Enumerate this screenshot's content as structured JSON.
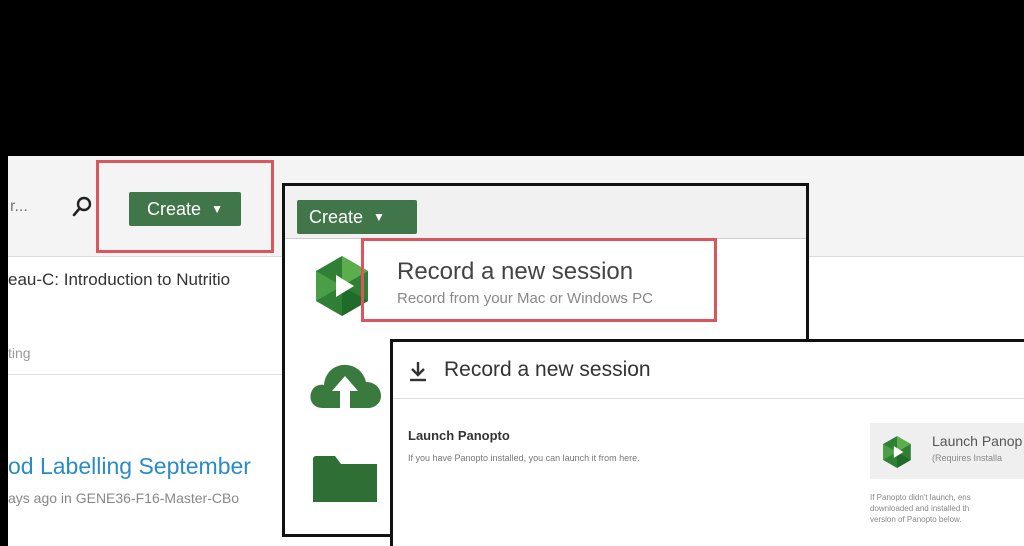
{
  "toolbar": {
    "search_fragment": "r...",
    "create_label": "Create"
  },
  "course": {
    "title_fragment": "eau-C: Introduction to Nutritio",
    "meeting_fragment": "ting"
  },
  "recent_item": {
    "title_fragment": "od Labelling September",
    "meta_fragment": "ays ago in GENE36-F16-Master-CBo"
  },
  "create_menu": {
    "button_label": "Create",
    "items": [
      {
        "title": "Record a new session",
        "subtitle": "Record from your Mac or Windows PC",
        "icon": "panopto-record-icon"
      },
      {
        "icon": "cloud-upload-icon"
      },
      {
        "icon": "folder-icon"
      }
    ]
  },
  "dialog": {
    "title": "Record a new session",
    "launch_heading": "Launch Panopto",
    "launch_description": "If you have Panopto installed, you can launch it from here.",
    "launch_button_title": "Launch Panop",
    "launch_button_subtitle": "(Requires Installa",
    "note_lines": [
      "If Panopto didn't launch, ens",
      "downloaded and installed th",
      "version of Panopto below."
    ]
  },
  "colors": {
    "create_green": "#41754a",
    "highlight_red": "#d9565e",
    "link_blue": "#2a8bc7",
    "panopto_green": "#3d9a3f"
  }
}
